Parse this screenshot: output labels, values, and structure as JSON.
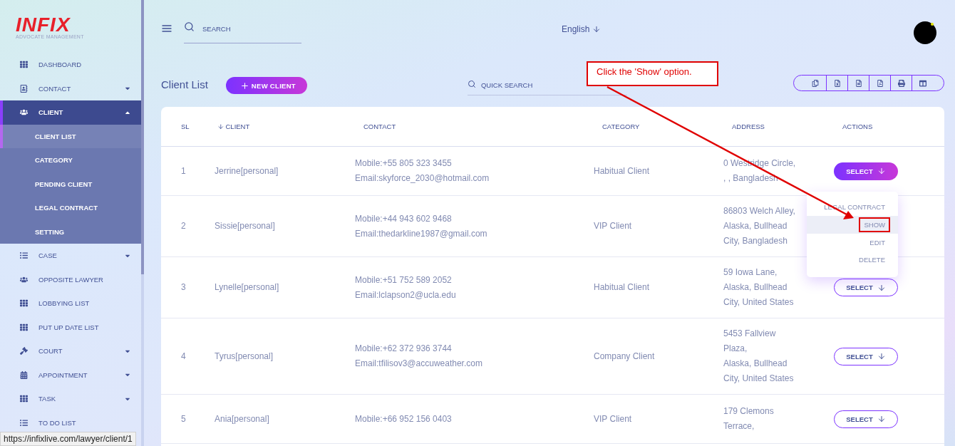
{
  "brand": {
    "name": "INFIX",
    "tagline": "ADVOCATE MANAGEMENT"
  },
  "sidebar": {
    "items": [
      {
        "label": "DASHBOARD",
        "kind": "grid",
        "selected": false
      },
      {
        "label": "CONTACT",
        "kind": "contact",
        "selected": false,
        "expanded": false
      },
      {
        "label": "CLIENT",
        "kind": "people",
        "selected": true,
        "expanded": true,
        "children": [
          {
            "label": "CLIENT LIST",
            "selected": true
          },
          {
            "label": "CATEGORY",
            "selected": false
          },
          {
            "label": "PENDING CLIENT",
            "selected": false
          },
          {
            "label": "LEGAL CONTRACT",
            "selected": false
          },
          {
            "label": "SETTING",
            "selected": false
          }
        ]
      },
      {
        "label": "CASE",
        "kind": "list",
        "selected": false,
        "expanded": false
      },
      {
        "label": "OPPOSITE LAWYER",
        "kind": "people",
        "selected": false
      },
      {
        "label": "LOBBYING LIST",
        "kind": "grid",
        "selected": false
      },
      {
        "label": "PUT UP DATE LIST",
        "kind": "grid",
        "selected": false
      },
      {
        "label": "COURT",
        "kind": "gavel",
        "selected": false,
        "expanded": false
      },
      {
        "label": "APPOINTMENT",
        "kind": "calendar",
        "selected": false,
        "expanded": false
      },
      {
        "label": "TASK",
        "kind": "grid",
        "selected": false,
        "expanded": false
      },
      {
        "label": "TO DO LIST",
        "kind": "list",
        "selected": false
      }
    ]
  },
  "topbar": {
    "search": {
      "placeholder": "SEARCH"
    },
    "language": "English"
  },
  "page": {
    "title": "Client List",
    "new_button": "NEW CLIENT",
    "quick_search": {
      "placeholder": "QUICK SEARCH"
    },
    "export_buttons": [
      {
        "kind": "copy"
      },
      {
        "kind": "excel"
      },
      {
        "kind": "csv"
      },
      {
        "kind": "pdf"
      },
      {
        "kind": "print"
      },
      {
        "kind": "columns"
      }
    ]
  },
  "table": {
    "columns": [
      "SL",
      "CLIENT",
      "CONTACT",
      "CATEGORY",
      "ADDRESS",
      "ACTIONS"
    ],
    "rows": [
      {
        "sl": "1",
        "client": "Jerrine[personal]",
        "mobile": "Mobile:+55 805 323 3455",
        "email": "Email:skyforce_2030@hotmail.com",
        "category": "Habitual Client",
        "address_lines": [
          "0 Westridge Circle,",
          ", , Bangladesh"
        ],
        "action": "SELECT",
        "selected": true
      },
      {
        "sl": "2",
        "client": "Sissie[personal]",
        "mobile": "Mobile:+44 943 602 9468",
        "email": "Email:thedarkline1987@gmail.com",
        "category": "VIP Client",
        "address_lines": [
          "86803 Welch Alley,",
          "Alaska, Bullhead",
          "City, Bangladesh"
        ],
        "selected": false
      },
      {
        "sl": "3",
        "client": "Lynelle[personal]",
        "mobile": "Mobile:+51 752 589 2052",
        "email": "Email:lclapson2@ucla.edu",
        "category": "Habitual Client",
        "address_lines": [
          "59 Iowa Lane,",
          "Alaska, Bullhead",
          "City, United States"
        ],
        "action": "SELECT",
        "selected": false
      },
      {
        "sl": "4",
        "client": "Tyrus[personal]",
        "mobile": "Mobile:+62 372 936 3744",
        "email": "Email:tfilisov3@accuweather.com",
        "category": "Company Client",
        "address_lines": [
          "5453 Fallview",
          "Plaza,",
          "Alaska, Bullhead",
          "City, United States"
        ],
        "action": "SELECT",
        "selected": false
      },
      {
        "sl": "5",
        "client": "Ania[personal]",
        "mobile": "Mobile:+66 952 156 0403",
        "category": "VIP Client",
        "address_lines": [
          "179 Clemons",
          "Terrace,"
        ],
        "action": "SELECT",
        "selected": false
      }
    ]
  },
  "action_menu": {
    "items": [
      {
        "label": "LEGAL CONTRACT",
        "selected": false,
        "outlined": false
      },
      {
        "label": "SHOW",
        "selected": true,
        "outlined": true
      },
      {
        "label": "EDIT",
        "selected": false,
        "outlined": false
      },
      {
        "label": "DELETE",
        "selected": false,
        "outlined": false
      }
    ]
  },
  "annotation": {
    "text": "Click the 'Show' option."
  },
  "status_url": "https://infixlive.com/lawyer/client/1"
}
